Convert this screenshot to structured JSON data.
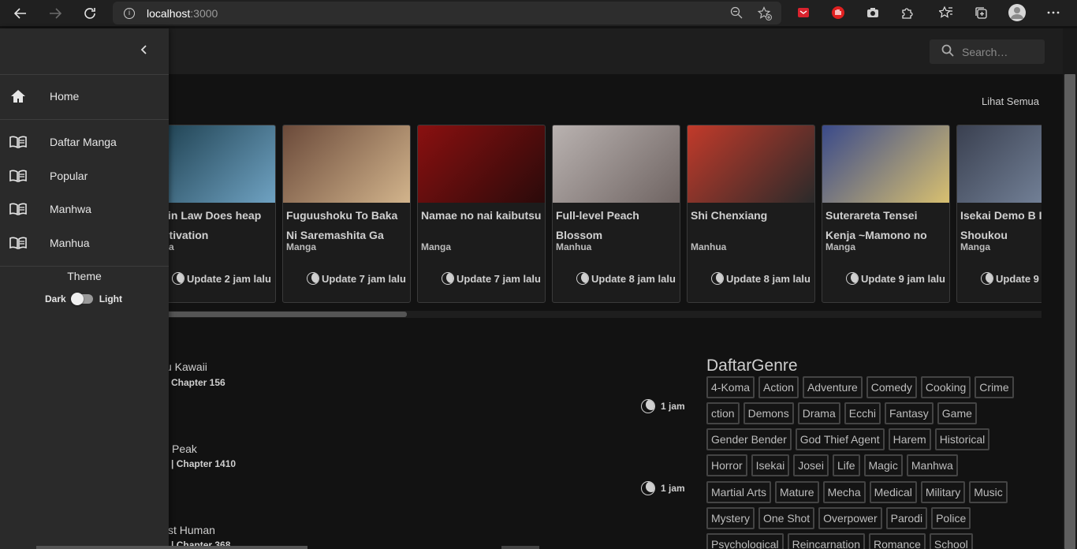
{
  "browser": {
    "url_host": "localhost",
    "url_port": ":3000"
  },
  "header": {
    "search_placeholder": "Search…"
  },
  "section": {
    "see_all": "Lihat Semua"
  },
  "cards": [
    {
      "title": "on in Law Does heap Cultivation",
      "type": "nhua",
      "update": "Update 2 jam lalu",
      "colors": [
        "#1a3b4a",
        "#6fa2c2"
      ]
    },
    {
      "title": "Fuguushoku To Baka Ni Saremashita Ga",
      "type": "Manga",
      "update": "Update 7 jam lalu",
      "colors": [
        "#6b4a3a",
        "#d2b48c"
      ]
    },
    {
      "title": "Namae no nai kaibutsu",
      "type": "Manga",
      "update": "Update 7 jam lalu",
      "colors": [
        "#8a1010",
        "#2a0a0a"
      ]
    },
    {
      "title": "Full-level Peach Blossom",
      "type": "Manhua",
      "update": "Update 8 jam lalu",
      "colors": [
        "#b9b2b0",
        "#6f6462"
      ]
    },
    {
      "title": "Shi Chenxiang",
      "type": "Manhua",
      "update": "Update 8 jam lalu",
      "colors": [
        "#c23a2a",
        "#2a2a2a"
      ]
    },
    {
      "title": "Suterareta Tensei Kenja ~Mamono no",
      "type": "Manga",
      "update": "Update 9 jam lalu",
      "colors": [
        "#3a4a8a",
        "#d8c070"
      ]
    },
    {
      "title": "Isekai Demo B Ikitai Shoukou",
      "type": "Manga",
      "update": "Update 9",
      "colors": [
        "#3a4050",
        "#8090a8"
      ]
    }
  ],
  "latest": [
    {
      "title": "ku Kawaii",
      "chapter": "Chapter 156",
      "time": "1 jam"
    },
    {
      "title": "Peak",
      "chapter": "| Chapter 1410",
      "time": "1 jam"
    },
    {
      "title": "st Human",
      "chapter": "| Chapter 368",
      "time": ""
    }
  ],
  "genre_title": "DaftarGenre",
  "genres": [
    "4-Koma",
    "Action",
    "Adventure",
    "Comedy",
    "Cooking",
    "Crime",
    "ction",
    "Demons",
    "Drama",
    "Ecchi",
    "Fantasy",
    "Game",
    "Gender Bender",
    "God Thief Agent",
    "Harem",
    "Historical",
    "Horror",
    "Isekai",
    "Josei",
    "Life",
    "Magic",
    "Manhwa",
    "Martial Arts",
    "Mature",
    "Mecha",
    "Medical",
    "Military",
    "Music",
    "Mystery",
    "One Shot",
    "Overpower",
    "Parodi",
    "Police",
    "Psychological",
    "Reincarnation",
    "Romance",
    "School"
  ],
  "drawer": {
    "items": [
      {
        "label": "Home",
        "icon": "home-icon"
      },
      {
        "label": "Daftar Manga",
        "icon": "book-icon"
      },
      {
        "label": "Popular",
        "icon": "book-icon"
      },
      {
        "label": "Manhwa",
        "icon": "book-icon"
      },
      {
        "label": "Manhua",
        "icon": "book-icon"
      }
    ],
    "theme_label": "Theme",
    "dark_label": "Dark",
    "light_label": "Light"
  }
}
